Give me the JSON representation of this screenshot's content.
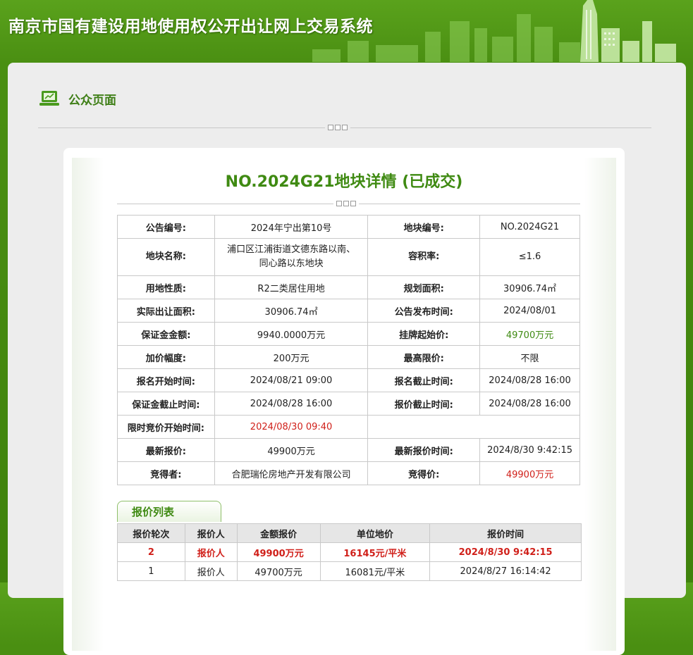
{
  "header": {
    "title": "南京市国有建设用地使用权公开出让网上交易系统"
  },
  "panel": {
    "title": "公众页面",
    "icon": "laptop-icon"
  },
  "detail": {
    "title": "NO.2024G21地块详情 (已成交)",
    "rows": [
      {
        "l1": "公告编号:",
        "v1": "2024年宁出第10号",
        "l2": "地块编号:",
        "v2": "NO.2024G21"
      },
      {
        "l1": "地块名称:",
        "v1": "浦口区江浦街道文德东路以南、同心路以东地块",
        "l2": "容积率:",
        "v2": "≤1.6"
      },
      {
        "l1": "用地性质:",
        "v1": "R2二类居住用地",
        "l2": "规划面积:",
        "v2": "30906.74㎡"
      },
      {
        "l1": "实际出让面积:",
        "v1": "30906.74㎡",
        "l2": "公告发布时间:",
        "v2": "2024/08/01"
      },
      {
        "l1": "保证金金额:",
        "v1": "9940.0000万元",
        "l2": "挂牌起始价:",
        "v2": "49700万元"
      },
      {
        "l1": "加价幅度:",
        "v1": "200万元",
        "l2": "最高限价:",
        "v2": "不限"
      },
      {
        "l1": "报名开始时间:",
        "v1": "2024/08/21 09:00",
        "l2": "报名截止时间:",
        "v2": "2024/08/28 16:00"
      },
      {
        "l1": "保证金截止时间:",
        "v1": "2024/08/28 16:00",
        "l2": "报价截止时间:",
        "v2": "2024/08/28 16:00"
      },
      {
        "l1": "限时竞价开始时间:",
        "v1": "2024/08/30 09:40"
      },
      {
        "l1": "最新报价:",
        "v1": "49900万元",
        "l2": "最新报价时间:",
        "v2": "2024/8/30 9:42:15"
      },
      {
        "l1": "竞得者:",
        "v1": "合肥瑞伦房地产开发有限公司",
        "l2": "竞得价:",
        "v2": "49900万元"
      }
    ]
  },
  "bids": {
    "tab_label": "报价列表",
    "headers": [
      "报价轮次",
      "报价人",
      "金额报价",
      "单位地价",
      "报价时间"
    ],
    "rows": [
      [
        "2",
        "报价人",
        "49900万元",
        "16145元/平米",
        "2024/8/30 9:42:15"
      ],
      [
        "1",
        "报价人",
        "49700万元",
        "16081元/平米",
        "2024/8/27 16:14:42"
      ]
    ]
  },
  "colors": {
    "brand_green": "#3f8a12",
    "header_green": "#4a8f12",
    "alert_red": "#d0201a"
  }
}
